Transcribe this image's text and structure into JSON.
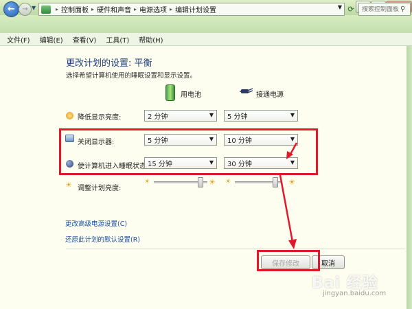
{
  "window": {
    "controls": {
      "minimize": "—",
      "maximize": "□",
      "close": "✕"
    }
  },
  "address": {
    "breadcrumbs": [
      "控制面板",
      "硬件和声音",
      "电源选项",
      "编辑计划设置"
    ],
    "search_placeholder": "搜索控制面板"
  },
  "menu": [
    "文件(F)",
    "编辑(E)",
    "查看(V)",
    "工具(T)",
    "帮助(H)"
  ],
  "page": {
    "title": "更改计划的设置: 平衡",
    "subtitle": "选择希望计算机使用的睡眠设置和显示设置。",
    "col_battery": "用电池",
    "col_plugged": "接通电源"
  },
  "settings": [
    {
      "label": "降低显示亮度:",
      "battery": "2 分钟",
      "plugged": "5 分钟"
    },
    {
      "label": "关闭显示器:",
      "battery": "5 分钟",
      "plugged": "10 分钟"
    },
    {
      "label": "使计算机进入睡眠状态:",
      "battery": "15 分钟",
      "plugged": "30 分钟"
    }
  ],
  "brightness": {
    "label": "调整计划亮度:",
    "battery_level": 0.92,
    "plugged_level": 0.92
  },
  "links": {
    "advanced": "更改高级电源设置(C)",
    "restore": "还原此计划的默认设置(R)"
  },
  "buttons": {
    "save": "保存修改",
    "cancel": "取消"
  },
  "watermark": {
    "brand": "Bai 经验",
    "url": "jingyan.baidu.com"
  },
  "colors": {
    "annotation": "#e0192b",
    "link": "#1a4fa0",
    "title": "#1e3e7d"
  }
}
